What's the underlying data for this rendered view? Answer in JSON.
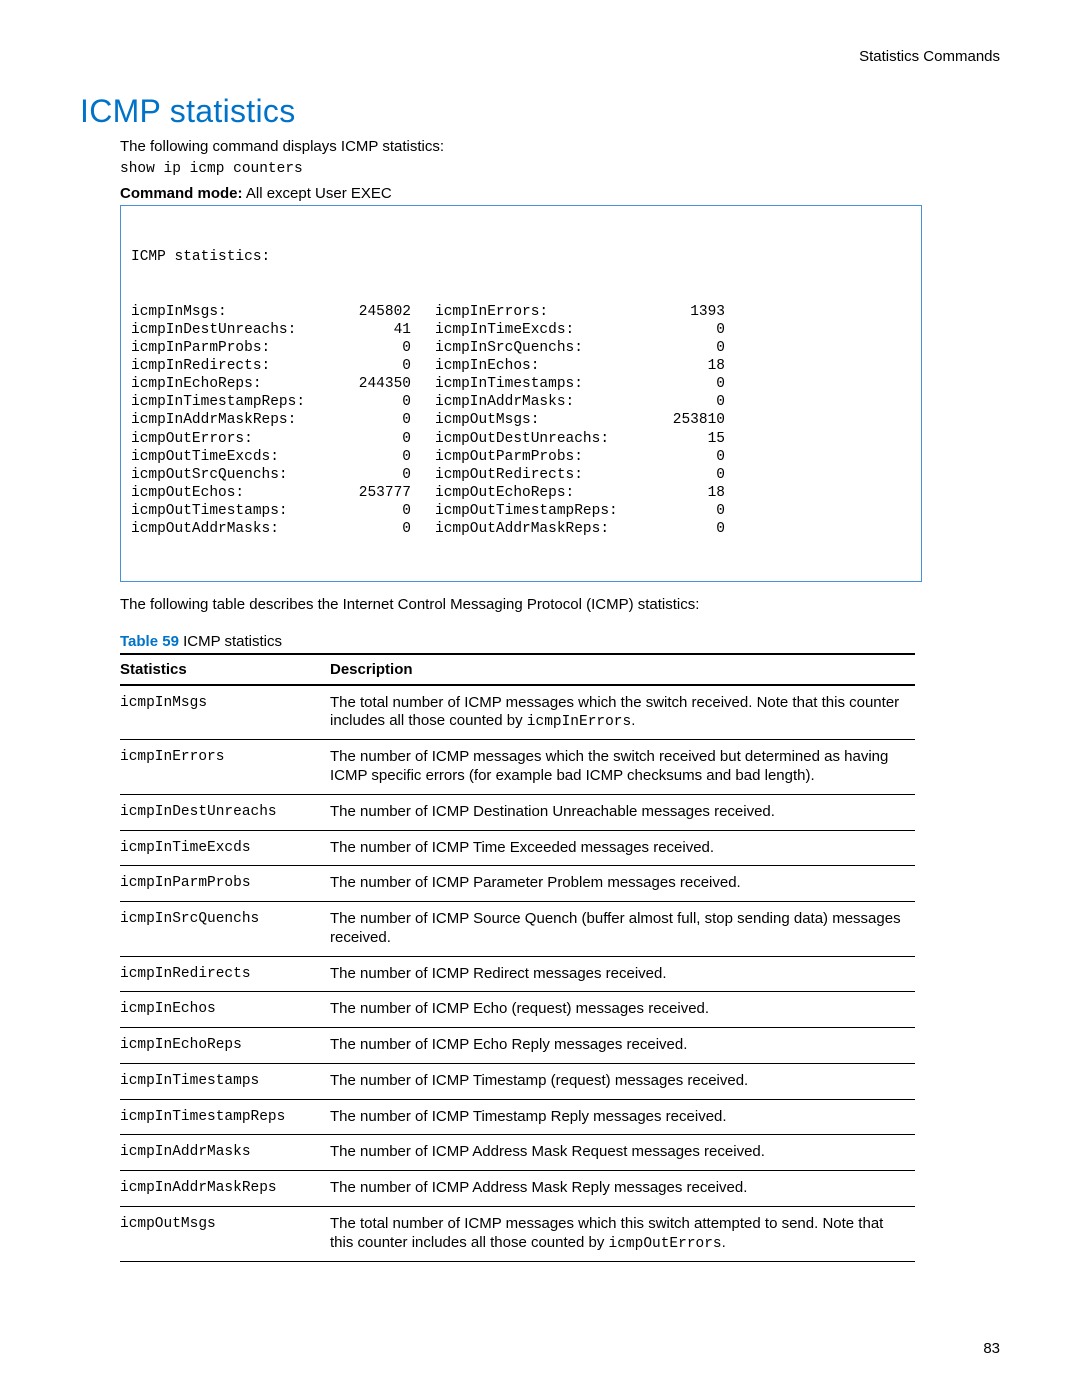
{
  "header_right": "Statistics Commands",
  "title": "ICMP statistics",
  "intro_text": "The following command displays ICMP statistics:",
  "command_text": "show ip icmp counters",
  "cmd_mode_label": "Command mode:",
  "cmd_mode_value": " All except User EXEC",
  "output_title": "ICMP statistics:",
  "output_rows": [
    {
      "l1": "icmpInMsgs:",
      "v1": "245802",
      "l2": "icmpInErrors:",
      "v2": "1393"
    },
    {
      "l1": "icmpInDestUnreachs:",
      "v1": "41",
      "l2": "icmpInTimeExcds:",
      "v2": "0"
    },
    {
      "l1": "icmpInParmProbs:",
      "v1": "0",
      "l2": "icmpInSrcQuenchs:",
      "v2": "0"
    },
    {
      "l1": "icmpInRedirects:",
      "v1": "0",
      "l2": "icmpInEchos:",
      "v2": "18"
    },
    {
      "l1": "icmpInEchoReps:",
      "v1": "244350",
      "l2": "icmpInTimestamps:",
      "v2": "0"
    },
    {
      "l1": "icmpInTimestampReps:",
      "v1": "0",
      "l2": "icmpInAddrMasks:",
      "v2": "0"
    },
    {
      "l1": "icmpInAddrMaskReps:",
      "v1": "0",
      "l2": "icmpOutMsgs:",
      "v2": "253810"
    },
    {
      "l1": "icmpOutErrors:",
      "v1": "0",
      "l2": "icmpOutDestUnreachs:",
      "v2": "15"
    },
    {
      "l1": "icmpOutTimeExcds:",
      "v1": "0",
      "l2": "icmpOutParmProbs:",
      "v2": "0"
    },
    {
      "l1": "icmpOutSrcQuenchs:",
      "v1": "0",
      "l2": "icmpOutRedirects:",
      "v2": "0"
    },
    {
      "l1": "icmpOutEchos:",
      "v1": "253777",
      "l2": "icmpOutEchoReps:",
      "v2": "18"
    },
    {
      "l1": "icmpOutTimestamps:",
      "v1": "0",
      "l2": "icmpOutTimestampReps:",
      "v2": "0"
    },
    {
      "l1": "icmpOutAddrMasks:",
      "v1": "0",
      "l2": "icmpOutAddrMaskReps:",
      "v2": "0"
    }
  ],
  "table_intro": "The following table describes the Internet Control Messaging Protocol (ICMP) statistics:",
  "table_caption_number": "Table 59",
  "table_caption_text": "  ICMP statistics",
  "col_stat": "Statistics",
  "col_desc": "Description",
  "stats_table": [
    {
      "stat": "icmpInMsgs",
      "desc": [
        "The total number of ICMP messages which the switch received. Note that this counter includes all those counted by ",
        "icmpInErrors",
        "."
      ]
    },
    {
      "stat": "icmpInErrors",
      "desc": [
        "The number of ICMP messages which the switch received but determined as having ICMP specific errors (for example bad ICMP checksums and bad length)."
      ]
    },
    {
      "stat": "icmpInDestUnreachs",
      "desc": [
        "The number of ICMP Destination Unreachable messages received."
      ]
    },
    {
      "stat": "icmpInTimeExcds",
      "desc": [
        "The number of ICMP Time Exceeded messages received."
      ]
    },
    {
      "stat": "icmpInParmProbs",
      "desc": [
        "The number of ICMP Parameter Problem messages received."
      ]
    },
    {
      "stat": "icmpInSrcQuenchs",
      "desc": [
        "The number of ICMP Source Quench (buffer almost full, stop sending data) messages received."
      ]
    },
    {
      "stat": "icmpInRedirects",
      "desc": [
        "The number of ICMP Redirect messages received."
      ]
    },
    {
      "stat": "icmpInEchos",
      "desc": [
        "The number of ICMP Echo (request) messages received."
      ]
    },
    {
      "stat": "icmpInEchoReps",
      "desc": [
        "The number of ICMP Echo Reply messages received."
      ]
    },
    {
      "stat": "icmpInTimestamps",
      "desc": [
        "The number of ICMP Timestamp (request) messages received."
      ]
    },
    {
      "stat": "icmpInTimestampReps",
      "desc": [
        "The number of ICMP Timestamp Reply messages received."
      ]
    },
    {
      "stat": "icmpInAddrMasks",
      "desc": [
        "The number of ICMP Address Mask Request messages received."
      ]
    },
    {
      "stat": "icmpInAddrMaskReps",
      "desc": [
        "The number of ICMP Address Mask Reply messages received."
      ]
    },
    {
      "stat": "icmpOutMsgs",
      "desc": [
        "The total number of ICMP messages which this switch attempted to send. Note that this counter includes all those counted by ",
        "icmpOutErrors",
        "."
      ]
    }
  ],
  "page_number": "83"
}
